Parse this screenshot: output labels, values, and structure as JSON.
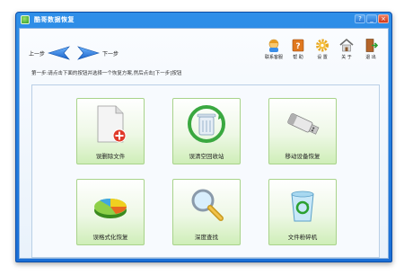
{
  "window": {
    "title": "酷哥数据恢复",
    "controls": {
      "help": "?",
      "minimize": "_",
      "close": "×"
    }
  },
  "nav": {
    "prev_label": "上一步",
    "next_label": "下一步"
  },
  "toolbar": {
    "items": [
      {
        "label": "联系客服",
        "icon": "support-person-icon"
      },
      {
        "label": "帮 助",
        "icon": "help-book-icon"
      },
      {
        "label": "设 置",
        "icon": "gear-icon"
      },
      {
        "label": "关 于",
        "icon": "home-icon"
      },
      {
        "label": "退 出",
        "icon": "exit-door-icon"
      }
    ]
  },
  "instruction": "第一步:请点击下面的按钮并选择一个恢复方案,然后点击[下一步]按钮",
  "cards": [
    {
      "label": "误删除文件",
      "icon": "deleted-file-icon"
    },
    {
      "label": "误清空回收站",
      "icon": "recycle-bin-icon"
    },
    {
      "label": "移动设备恢复",
      "icon": "usb-drive-icon"
    },
    {
      "label": "误格式化恢复",
      "icon": "disk-pie-icon"
    },
    {
      "label": "深度查找",
      "icon": "magnifier-icon"
    },
    {
      "label": "文件粉碎机",
      "icon": "shredder-bin-icon"
    }
  ],
  "colors": {
    "titlebar": "#1b6fd6",
    "card_green": "#cfeeb8",
    "arrow_blue": "#1f78d8"
  }
}
